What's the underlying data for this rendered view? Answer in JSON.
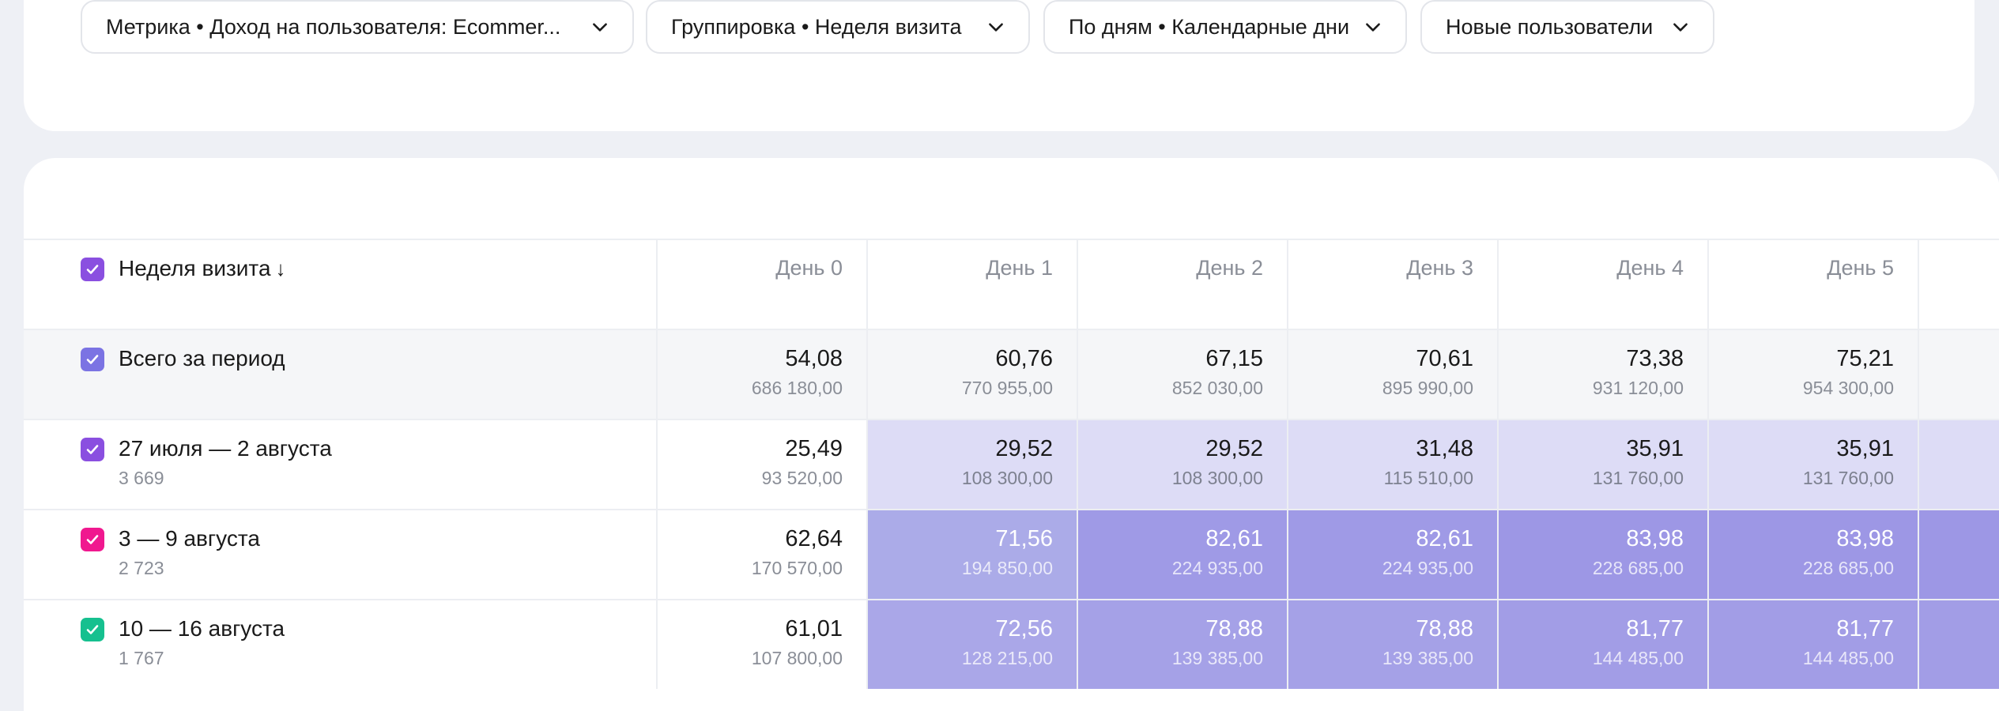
{
  "filters": [
    {
      "label": "Метрика • Доход на пользователя: Ecommer..."
    },
    {
      "label": "Группировка • Неделя визита"
    },
    {
      "label": "По дням • Календарные дни"
    },
    {
      "label": "Новые пользователи"
    }
  ],
  "table": {
    "header_label": "Неделя визита",
    "sort_arrow": "↓",
    "columns": [
      "День 0",
      "День 1",
      "День 2",
      "День 3",
      "День 4",
      "День 5"
    ],
    "total": {
      "label": "Всего за период",
      "values": [
        {
          "main": "54,08",
          "sub": "686 180,00"
        },
        {
          "main": "60,76",
          "sub": "770 955,00"
        },
        {
          "main": "67,15",
          "sub": "852 030,00"
        },
        {
          "main": "70,61",
          "sub": "895 990,00"
        },
        {
          "main": "73,38",
          "sub": "931 120,00"
        },
        {
          "main": "75,21",
          "sub": "954 300,00"
        }
      ]
    },
    "rows": [
      {
        "label": "27 июля — 2 августа",
        "count": "3 669",
        "check_color": "#8a4fe0",
        "values": [
          {
            "main": "25,49",
            "sub": "93 520,00"
          },
          {
            "main": "29,52",
            "sub": "108 300,00"
          },
          {
            "main": "29,52",
            "sub": "108 300,00"
          },
          {
            "main": "31,48",
            "sub": "115 510,00"
          },
          {
            "main": "35,91",
            "sub": "131 760,00"
          },
          {
            "main": "35,91",
            "sub": "131 760,00"
          }
        ]
      },
      {
        "label": "3 — 9 августа",
        "count": "2 723",
        "check_color": "#f0188f",
        "values": [
          {
            "main": "62,64",
            "sub": "170 570,00"
          },
          {
            "main": "71,56",
            "sub": "194 850,00"
          },
          {
            "main": "82,61",
            "sub": "224 935,00"
          },
          {
            "main": "82,61",
            "sub": "224 935,00"
          },
          {
            "main": "83,98",
            "sub": "228 685,00"
          },
          {
            "main": "83,98",
            "sub": "228 685,00"
          }
        ]
      },
      {
        "label": "10 — 16 августа",
        "count": "1 767",
        "check_color": "#16c08f",
        "values": [
          {
            "main": "61,01",
            "sub": "107 800,00"
          },
          {
            "main": "72,56",
            "sub": "128 215,00"
          },
          {
            "main": "78,88",
            "sub": "139 385,00"
          },
          {
            "main": "78,88",
            "sub": "139 385,00"
          },
          {
            "main": "81,77",
            "sub": "144 485,00"
          },
          {
            "main": "81,77",
            "sub": "144 485,00"
          }
        ]
      }
    ]
  },
  "colors": {
    "header_check": "#8a4fe0",
    "total_check": "#7b73e3",
    "light_fill": "#dddcf6",
    "mid_fill": "#a9a5e8",
    "dark_fill": "#9e97e5"
  }
}
